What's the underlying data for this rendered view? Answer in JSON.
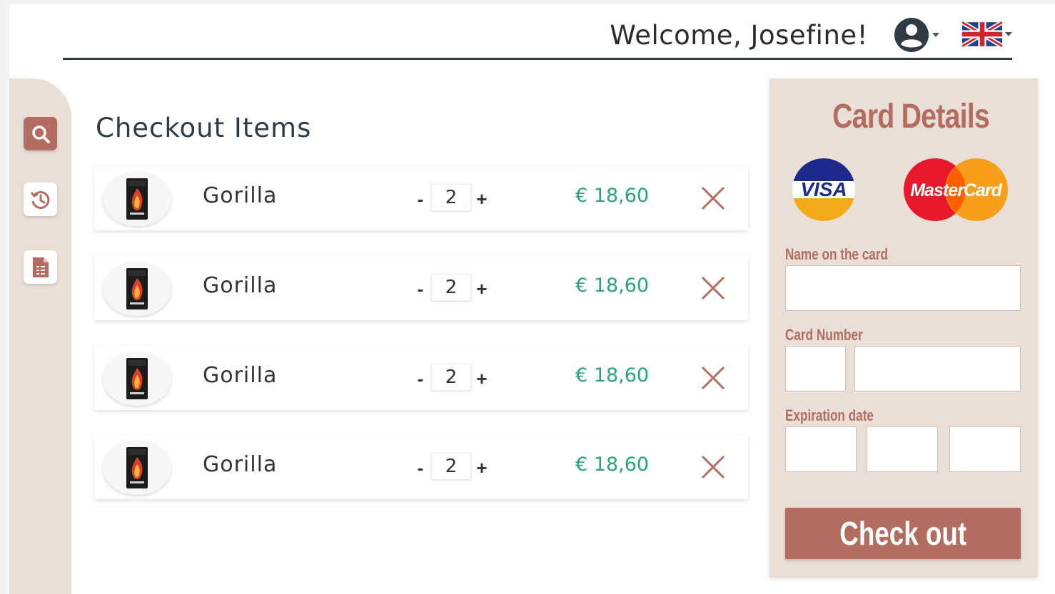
{
  "header": {
    "welcome": "Welcome, Josefine!",
    "user_icon": "user-circle-icon",
    "language_icon": "uk-flag-icon"
  },
  "sidebar": {
    "items": [
      {
        "icon": "search-icon",
        "active": true
      },
      {
        "icon": "history-icon",
        "active": false
      },
      {
        "icon": "receipt-icon",
        "active": false
      }
    ]
  },
  "main": {
    "title": "Checkout Items",
    "items": [
      {
        "name": "Gorilla",
        "quantity": "2",
        "price": "€ 18,60",
        "minus": "-",
        "plus": "+"
      },
      {
        "name": "Gorilla",
        "quantity": "2",
        "price": "€ 18,60",
        "minus": "-",
        "plus": "+"
      },
      {
        "name": "Gorilla",
        "quantity": "2",
        "price": "€ 18,60",
        "minus": "-",
        "plus": "+"
      },
      {
        "name": "Gorilla",
        "quantity": "2",
        "price": "€ 18,60",
        "minus": "-",
        "plus": "+"
      }
    ]
  },
  "card": {
    "title": "Card Details",
    "visa_text": "VISA",
    "mastercard_text": "MasterCard",
    "name_label": "Name on the card",
    "number_label": "Card Number",
    "expiration_label": "Expiration date",
    "checkout_label": "Check out"
  },
  "colors": {
    "accent": "#b36d60",
    "panel": "#e9dfd6",
    "price": "#27a577",
    "remove": "#b36d60"
  }
}
